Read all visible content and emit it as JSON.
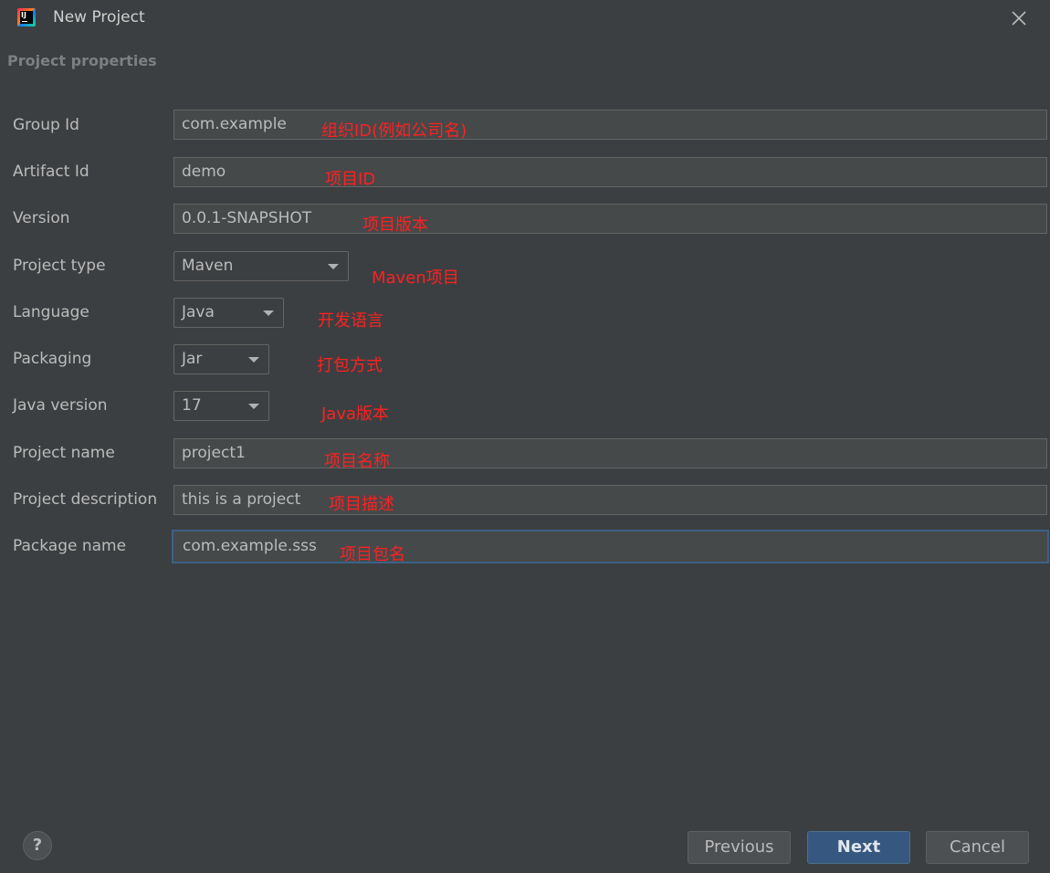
{
  "window": {
    "title": "New Project",
    "section_title": "Project properties"
  },
  "form": {
    "group_id": {
      "label": "Group Id",
      "value": "com.example",
      "note": "组织ID(例如公司名)"
    },
    "artifact_id": {
      "label": "Artifact Id",
      "value": "demo",
      "note": "项目ID"
    },
    "version": {
      "label": "Version",
      "value": "0.0.1-SNAPSHOT",
      "note": "项目版本"
    },
    "project_type": {
      "label": "Project type",
      "value": "Maven",
      "note": "Maven项目"
    },
    "language": {
      "label": "Language",
      "value": "Java",
      "note": "开发语言"
    },
    "packaging": {
      "label": "Packaging",
      "value": "Jar",
      "note": "打包方式"
    },
    "java_version": {
      "label": "Java version",
      "value": "17",
      "note": "Java版本"
    },
    "project_name": {
      "label": "Project name",
      "value": "project1",
      "note": "项目名称"
    },
    "project_description": {
      "label": "Project description",
      "value": "this is a project",
      "note": "项目描述"
    },
    "package_name": {
      "label": "Package name",
      "value": "com.example.sss",
      "note": "项目包名"
    }
  },
  "footer": {
    "help_label": "?",
    "previous_label": "Previous",
    "next_label": "Next",
    "cancel_label": "Cancel"
  },
  "colors": {
    "background": "#3c3f41",
    "annotation": "#ff2020",
    "primary_button": "#365880",
    "focus_border": "#3d6185"
  }
}
